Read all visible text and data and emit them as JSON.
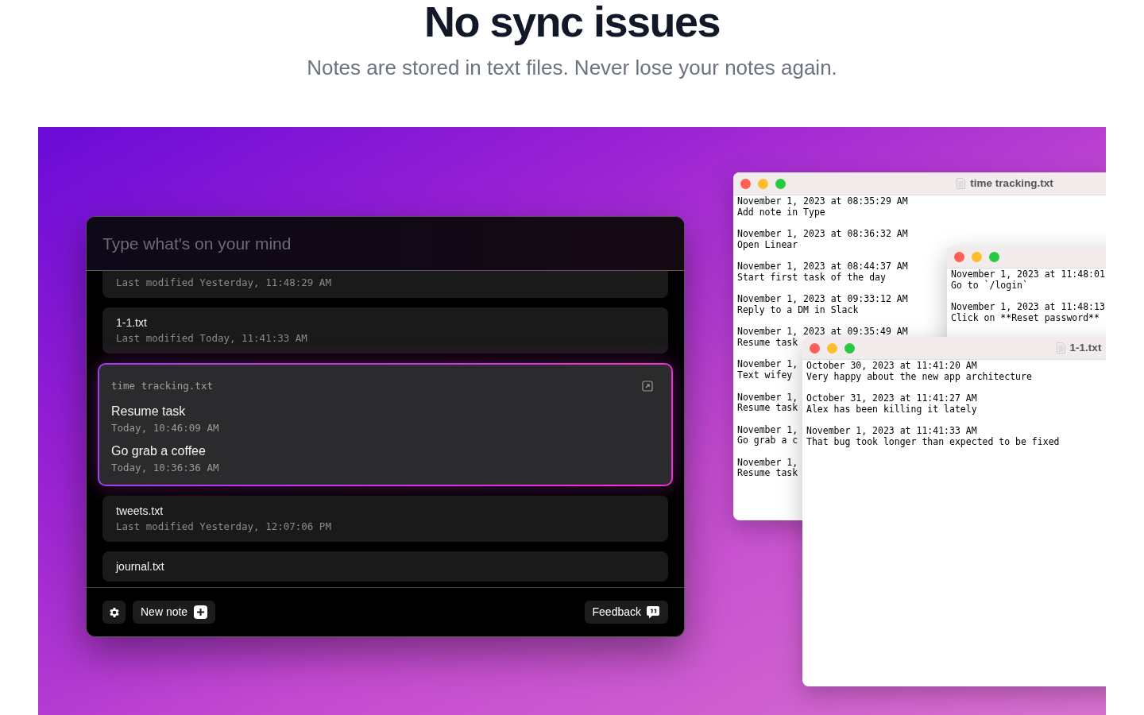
{
  "hero": {
    "title": "No sync issues",
    "subtitle": "Notes are stored in text files. Never lose your notes again."
  },
  "app": {
    "search": {
      "placeholder": "Type what's on your mind"
    },
    "notes": [
      {
        "kind": "summary",
        "selected": false,
        "meta": "Last modified Yesterday, 11:48:29 AM"
      },
      {
        "kind": "summary",
        "selected": false,
        "name": "1-1.txt",
        "meta": "Last modified Today, 11:41:33 AM"
      },
      {
        "kind": "entries",
        "selected": true,
        "name": "time tracking.txt",
        "entries": [
          {
            "text": "Resume task",
            "time": "Today, 10:46:09 AM"
          },
          {
            "text": "Go grab a coffee",
            "time": "Today, 10:36:36 AM"
          }
        ]
      },
      {
        "kind": "summary",
        "selected": false,
        "name": "tweets.txt",
        "meta": "Last modified Yesterday, 12:07:06 PM"
      },
      {
        "kind": "summary",
        "selected": false,
        "name": "journal.txt"
      }
    ],
    "footer": {
      "new_note": "New note",
      "feedback": "Feedback"
    }
  },
  "editors": [
    {
      "title": "time tracking.txt",
      "entries": [
        {
          "date": "November 1, 2023 at 08:35:29 AM",
          "text": "Add note in Type"
        },
        {
          "date": "November 1, 2023 at 08:36:32 AM",
          "text": "Open Linear"
        },
        {
          "date": "November 1, 2023 at 08:44:37 AM",
          "text": "Start first task of the day"
        },
        {
          "date": "November 1, 2023 at 09:33:12 AM",
          "text": "Reply to a DM in Slack"
        },
        {
          "date": "November 1, 2023 at 09:35:49 AM",
          "text": "Resume task"
        },
        {
          "date": "November 1,",
          "text": "Text wifey"
        },
        {
          "date": "November 1,",
          "text": "Resume task"
        },
        {
          "date": "November 1,",
          "text": "Go grab a c"
        },
        {
          "date": "November 1,",
          "text": "Resume task"
        }
      ]
    },
    {
      "entries": [
        {
          "date": "November 1, 2023 at 11:48:01",
          "text": "Go to `/login`"
        },
        {
          "date": "November 1, 2023 at 11:48:13",
          "text": "Click on **Reset password**"
        }
      ]
    },
    {
      "title": "1-1.txt",
      "entries": [
        {
          "date": "October 30, 2023 at 11:41:20 AM",
          "text": "Very happy about the new app architecture"
        },
        {
          "date": "October 31, 2023 at 11:41:27 AM",
          "text": "Alex has been killing it lately"
        },
        {
          "date": "November 1, 2023 at 11:41:33 AM",
          "text": "That bug took longer than expected to be fixed"
        }
      ]
    }
  ]
}
